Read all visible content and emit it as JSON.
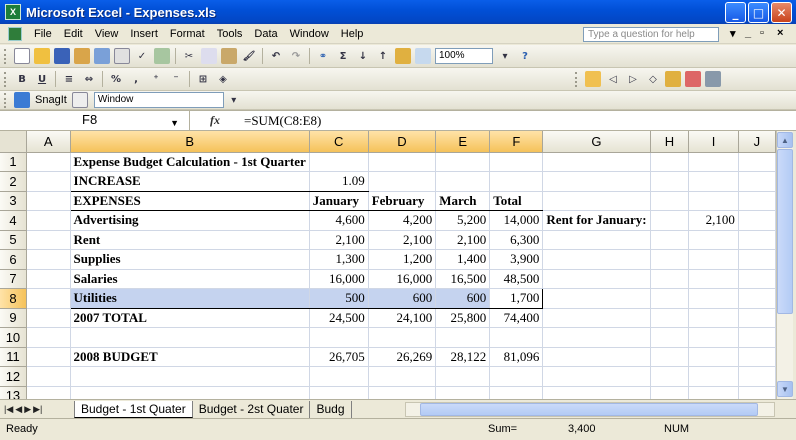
{
  "window": {
    "title": "Microsoft Excel - Expenses.xls",
    "app_icon": "excel-icon"
  },
  "menu": {
    "items": [
      "File",
      "Edit",
      "View",
      "Insert",
      "Format",
      "Tools",
      "Data",
      "Window",
      "Help"
    ],
    "question_placeholder": "Type a question for help"
  },
  "toolbar": {
    "zoom": "100%",
    "snagit_label": "SnagIt",
    "window_select": "Window"
  },
  "formula_bar": {
    "cell_ref": "F8",
    "fx": "fx",
    "formula": "=SUM(C8:E8)"
  },
  "columns": [
    "A",
    "B",
    "C",
    "D",
    "E",
    "F",
    "G",
    "H",
    "I",
    "J"
  ],
  "rows": [
    {
      "num": "1",
      "cells": [
        "",
        "Expense Budget Calculation - 1st Quarter",
        "",
        "",
        "",
        "",
        "",
        "",
        "",
        ""
      ]
    },
    {
      "num": "2",
      "cells": [
        "",
        "INCREASE",
        "1.09",
        "",
        "",
        "",
        "",
        "",
        "",
        ""
      ]
    },
    {
      "num": "3",
      "cells": [
        "",
        "EXPENSES",
        "January",
        "February",
        "March",
        "Total",
        "",
        "",
        "",
        ""
      ]
    },
    {
      "num": "4",
      "cells": [
        "",
        "Advertising",
        "4,600",
        "4,200",
        "5,200",
        "14,000",
        "Rent for January:",
        "",
        "2,100",
        ""
      ]
    },
    {
      "num": "5",
      "cells": [
        "",
        "Rent",
        "2,100",
        "2,100",
        "2,100",
        "6,300",
        "",
        "",
        "",
        ""
      ]
    },
    {
      "num": "6",
      "cells": [
        "",
        "Supplies",
        "1,300",
        "1,200",
        "1,400",
        "3,900",
        "",
        "",
        "",
        ""
      ]
    },
    {
      "num": "7",
      "cells": [
        "",
        "Salaries",
        "16,000",
        "16,000",
        "16,500",
        "48,500",
        "",
        "",
        "",
        ""
      ]
    },
    {
      "num": "8",
      "cells": [
        "",
        "Utilities",
        "500",
        "600",
        "600",
        "1,700",
        "",
        "",
        "",
        ""
      ]
    },
    {
      "num": "9",
      "cells": [
        "",
        "2007 TOTAL",
        "24,500",
        "24,100",
        "25,800",
        "74,400",
        "",
        "",
        "",
        ""
      ]
    },
    {
      "num": "10",
      "cells": [
        "",
        "",
        "",
        "",
        "",
        "",
        "",
        "",
        "",
        ""
      ]
    },
    {
      "num": "11",
      "cells": [
        "",
        "2008 BUDGET",
        "26,705",
        "26,269",
        "28,122",
        "81,096",
        "",
        "",
        "",
        ""
      ]
    },
    {
      "num": "12",
      "cells": [
        "",
        "",
        "",
        "",
        "",
        "",
        "",
        "",
        "",
        ""
      ]
    },
    {
      "num": "13",
      "cells": [
        "",
        "",
        "",
        "",
        "",
        "",
        "",
        "",
        "",
        ""
      ]
    }
  ],
  "sheet_tabs": [
    "Budget - 1st Quater",
    "Budget - 2st Quater",
    "Budg"
  ],
  "status": {
    "ready": "Ready",
    "sum_label": "Sum=",
    "sum_value": "3,400",
    "num": "NUM"
  }
}
